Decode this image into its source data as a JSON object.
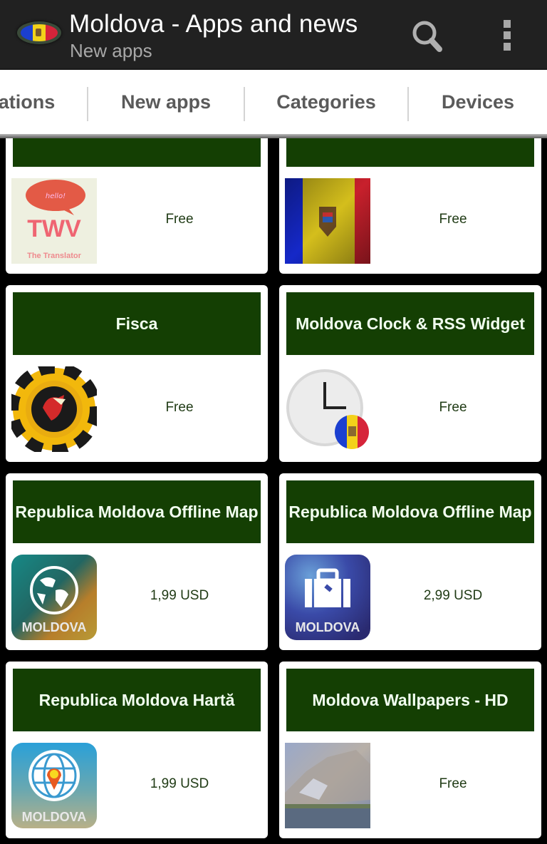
{
  "app": {
    "title": "Moldova - Apps and news",
    "subtitle": "New apps",
    "logo": "moldova-flag-oval",
    "actions": [
      {
        "name": "search",
        "icon": "search-icon"
      },
      {
        "name": "more-options",
        "icon": "overflow-menu-icon"
      }
    ]
  },
  "tabs": [
    {
      "label": "ations",
      "full_label_partially_hidden": true
    },
    {
      "label": "New apps",
      "selected": true
    },
    {
      "label": "Categories"
    },
    {
      "label": "Devices"
    }
  ],
  "colors": {
    "actionbar_bg": "#212121",
    "card_title_bg": "#143f03",
    "card_title_text": "#f2fff0",
    "price_text": "#1f3a14",
    "tab_text": "#5a5a5a"
  },
  "apps": [
    {
      "title": "",
      "price": "Free",
      "icon": "twv-translator-icon",
      "icon_texts": {
        "bubble": "hello!",
        "main": "TWV",
        "caption": "The Translator"
      }
    },
    {
      "title": "",
      "price": "Free",
      "icon": "moldova-flag-icon"
    },
    {
      "title": "Fisca",
      "price": "Free",
      "icon": "fisca-chip-icon"
    },
    {
      "title": "Moldova Clock & RSS Widget",
      "price": "Free",
      "icon": "clock-flag-icon"
    },
    {
      "title": "Republica Moldova Offline Map",
      "price": "1,99 USD",
      "icon": "globe-map-icon",
      "icon_label": "MOLDOVA"
    },
    {
      "title": "Republica Moldova Offline Map",
      "price": "2,99 USD",
      "icon": "suitcase-icon",
      "icon_label": "MOLDOVA"
    },
    {
      "title": "Republica Moldova Hartă",
      "price": "1,99 USD",
      "icon": "globe-pin-icon",
      "icon_label": "MOLDOVA"
    },
    {
      "title": "Moldova Wallpapers - HD",
      "price": "Free",
      "icon": "landscape-photo-icon"
    }
  ]
}
